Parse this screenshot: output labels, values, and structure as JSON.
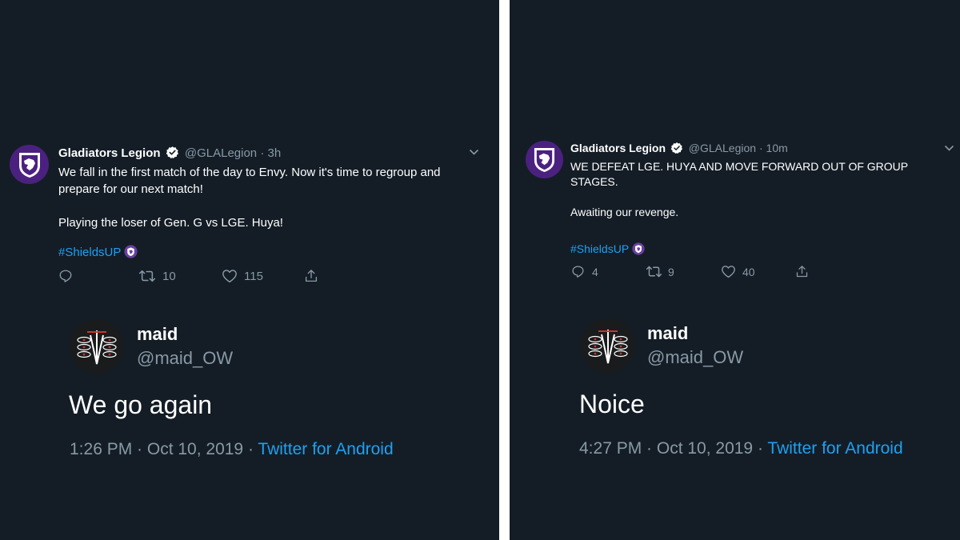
{
  "left": {
    "tweet": {
      "name": "Gladiators Legion",
      "handle": "@GLALegion",
      "dot": " · ",
      "time": "3h",
      "text": "We fall in the first match of the day to Envy. Now it's time to regroup and prepare for our next match!\n\nPlaying the loser of Gen. G vs LGE. Huya!",
      "hashtag": "#ShieldsUP",
      "replies": "",
      "retweets": "10",
      "likes": "115"
    },
    "quote": {
      "name": "maid",
      "handle": "@maid_OW",
      "text": "We go again",
      "time": "1:26 PM · Oct 10, 2019 · ",
      "source": "Twitter for Android"
    }
  },
  "right": {
    "tweet": {
      "name": "Gladiators Legion",
      "handle": "@GLALegion",
      "dot": " · ",
      "time": "10m",
      "text": "WE DEFEAT LGE. HUYA AND MOVE FORWARD OUT OF GROUP STAGES.\n\nAwaiting our revenge.",
      "hashtag": "#ShieldsUP",
      "replies": "4",
      "retweets": "9",
      "likes": "40"
    },
    "quote": {
      "name": "maid",
      "handle": "@maid_OW",
      "text": "Noice",
      "time": "4:27 PM · Oct 10, 2019 · ",
      "source": "Twitter for Android"
    }
  },
  "colors": {
    "background": "#141d26",
    "divider": "#ffffff",
    "link": "#1da1f2",
    "muted": "#8899a6",
    "brand_purple": "#4b2180"
  },
  "icons": {
    "avatar_gla": "gladiators-shield-logo",
    "avatar_maid": "maid-avatar-art",
    "verified": "verified-badge-icon",
    "caret": "chevron-down-icon",
    "reply": "reply-icon",
    "retweet": "retweet-icon",
    "like": "heart-icon",
    "share": "share-icon"
  }
}
